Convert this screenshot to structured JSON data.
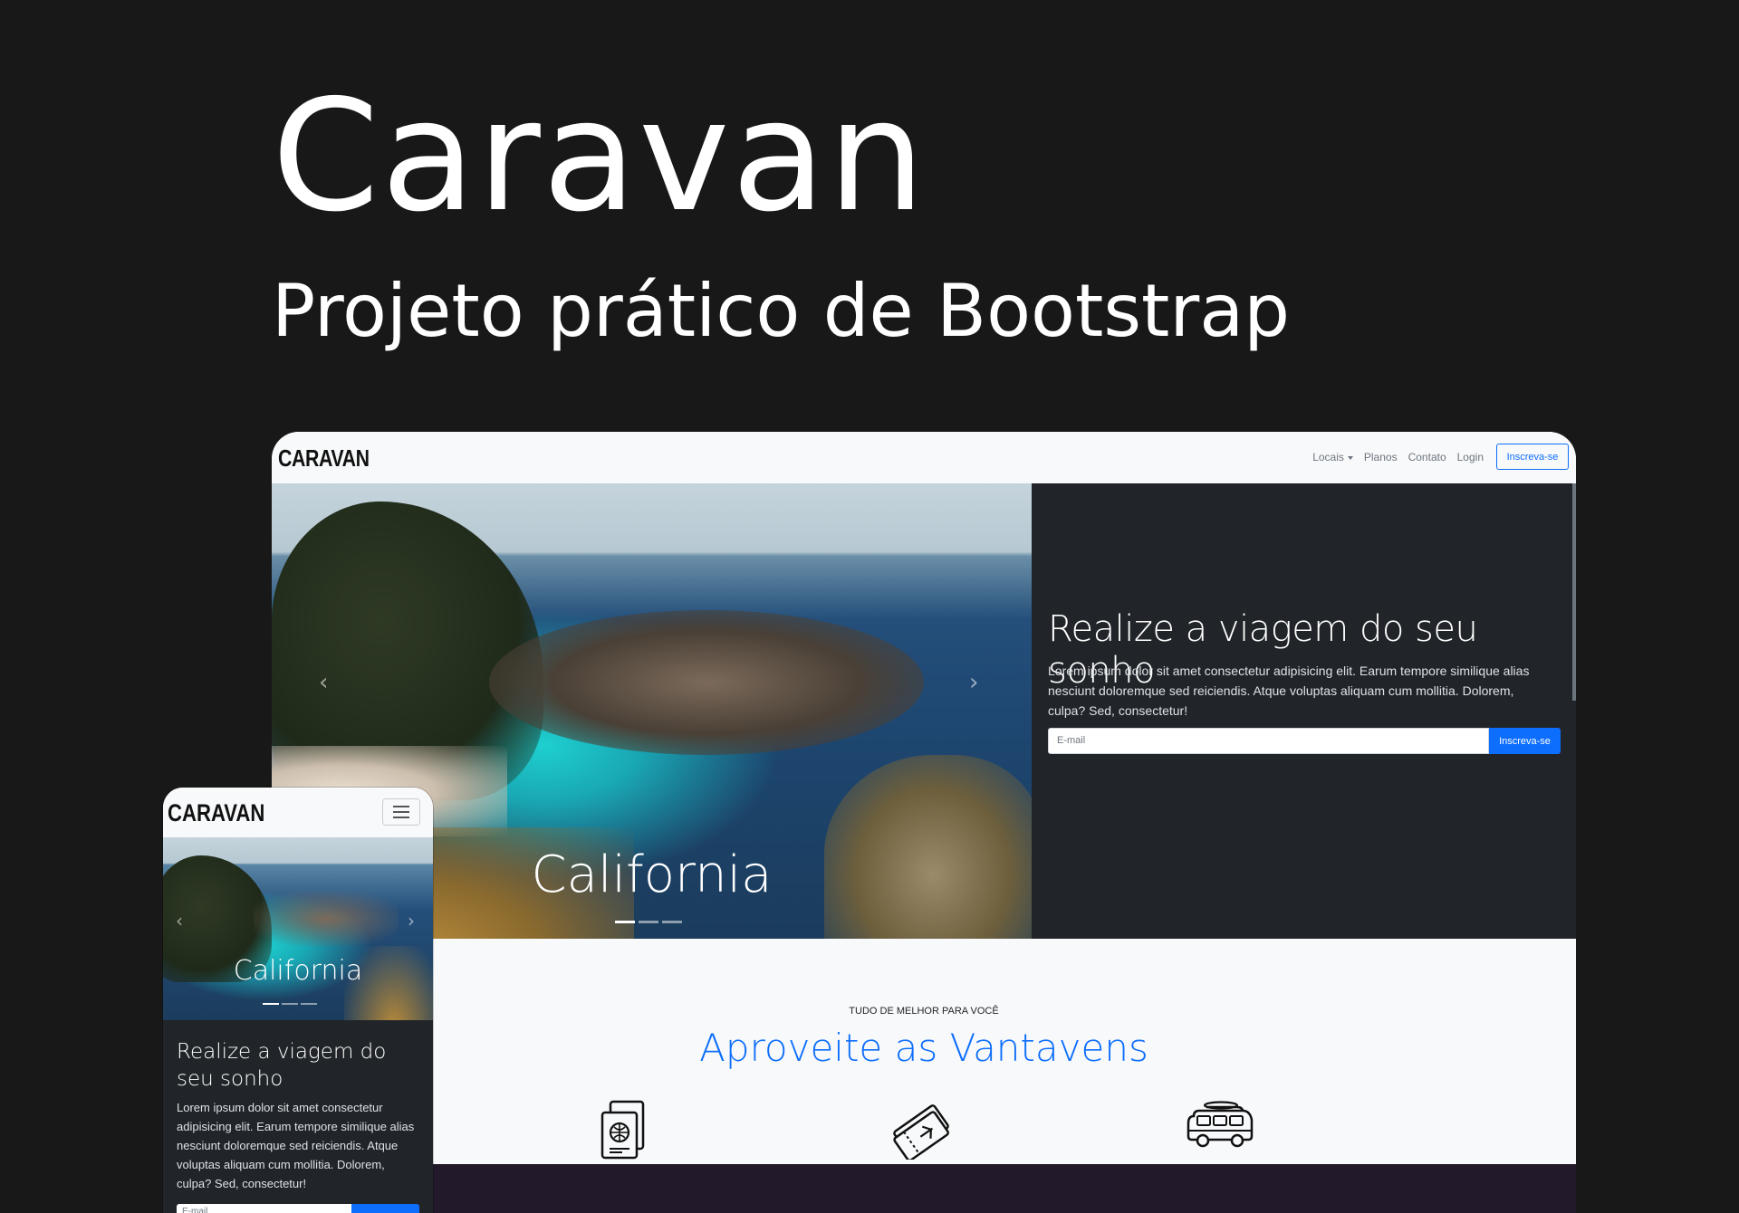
{
  "hero": {
    "title": "Caravan",
    "subtitle": "Projeto prático de Bootstrap"
  },
  "desktop": {
    "brand": "CARAVAN",
    "nav": {
      "locais": "Locais",
      "planos": "Planos",
      "contato": "Contato",
      "login": "Login",
      "cta": "Inscreva-se"
    },
    "carousel": {
      "caption": "California",
      "indicators": 3,
      "active_index": 0
    },
    "panel": {
      "heading": "Realize a viagem do seu sonho",
      "body": "Lorem ipsum dolor sit amet consectetur adipisicing elit. Earum tempore similique alias nesciunt doloremque sed reiciendis. Atque voluptas aliquam cum mollitia. Dolorem, culpa? Sed, consectetur!",
      "email_placeholder": "E-mail",
      "submit": "Inscreva-se"
    },
    "section": {
      "eyebrow": "TUDO DE MELHOR PARA VOCÊ",
      "title": "Aproveite as Vantavens",
      "icons": [
        "passport-icon",
        "ticket-icon",
        "van-icon"
      ]
    }
  },
  "mobile": {
    "brand": "CARAVAN",
    "caption": "California",
    "heading": "Realize a viagem do seu sonho",
    "body": "Lorem ipsum dolor sit amet consectetur adipisicing elit. Earum tempore similique alias nesciunt doloremque sed reiciendis. Atque voluptas aliquam cum mollitia. Dolorem, culpa? Sed, consectetur!",
    "email_placeholder": "E-mail"
  },
  "colors": {
    "background": "#181818",
    "primary": "#0d6efd",
    "dark_panel": "#212529",
    "light": "#f8f9fa",
    "footer": "#221a2a"
  }
}
